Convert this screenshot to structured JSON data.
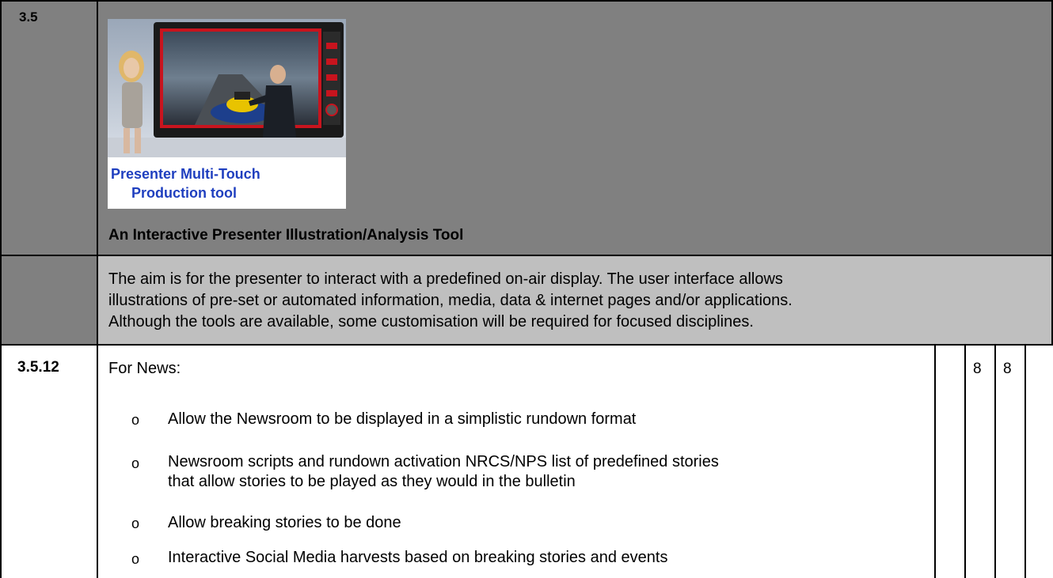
{
  "section": {
    "number": "3.5",
    "image_caption_line1": "Presenter Multi-Touch",
    "image_caption_line2": "Production tool",
    "subtitle": "An Interactive Presenter Illustration/Analysis Tool"
  },
  "description": {
    "lines": [
      "The aim is for the presenter to interact with a predefined on-air display. The user interface allows",
      "illustrations of pre-set or automated information, media, data & internet pages and/or applications.",
      "Although the tools are available, some customisation will be required for focused disciplines."
    ]
  },
  "requirement": {
    "number": "3.5.12",
    "heading": "For News:",
    "score_a": "8",
    "score_b": "8",
    "bullet_symbol": "o",
    "items": [
      "Allow the Newsroom to be displayed in a simplistic rundown format",
      "Newsroom scripts and rundown activation NRCS/NPS list of predefined stories",
      "that allow stories to be played as they would in the bulletin",
      "Allow breaking stories to be done",
      "Interactive Social Media harvests based on breaking stories and events"
    ]
  }
}
